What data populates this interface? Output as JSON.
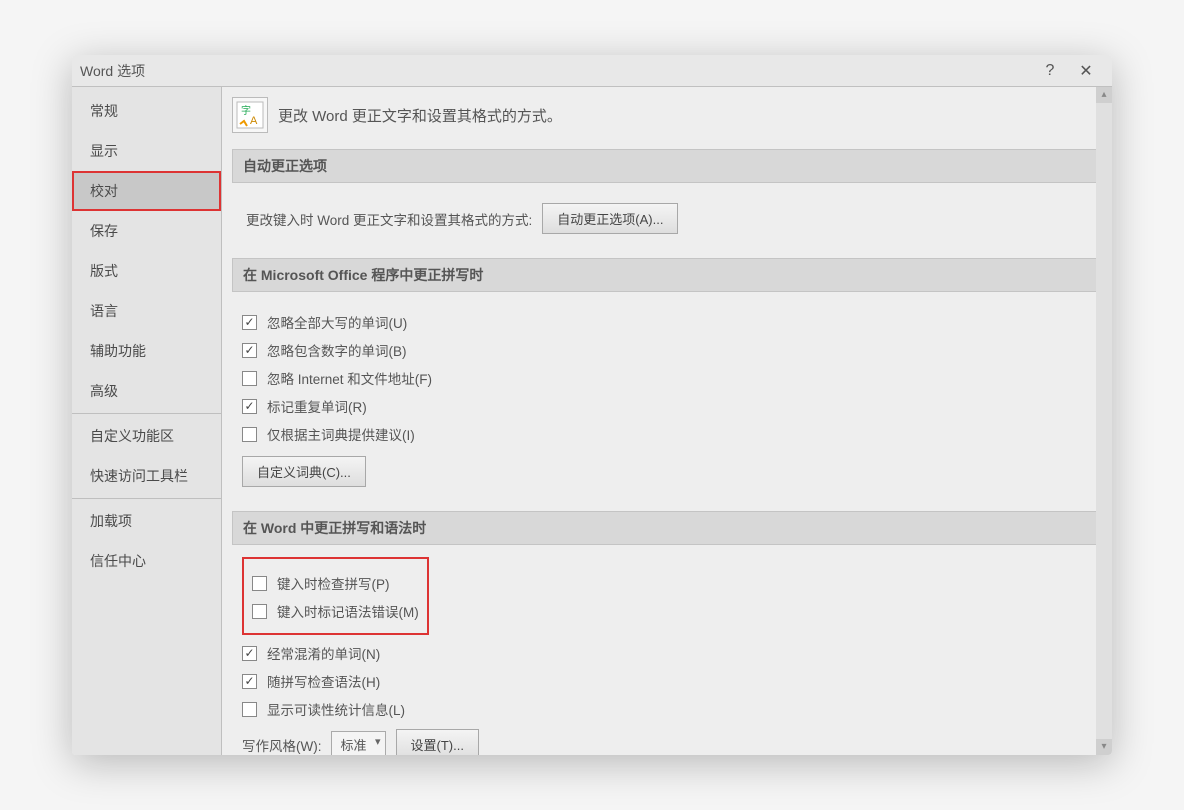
{
  "window": {
    "title": "Word 选项"
  },
  "sidebar": {
    "items": [
      {
        "label": "常规",
        "selected": false
      },
      {
        "label": "显示",
        "selected": false
      },
      {
        "label": "校对",
        "selected": true,
        "highlighted": true
      },
      {
        "label": "保存",
        "selected": false
      },
      {
        "label": "版式",
        "selected": false
      },
      {
        "label": "语言",
        "selected": false
      },
      {
        "label": "辅助功能",
        "selected": false
      },
      {
        "label": "高级",
        "selected": false
      }
    ],
    "items2": [
      {
        "label": "自定义功能区"
      },
      {
        "label": "快速访问工具栏"
      }
    ],
    "items3": [
      {
        "label": "加载项"
      },
      {
        "label": "信任中心"
      }
    ]
  },
  "header": {
    "icon_text": "字A",
    "title": "更改 Word 更正文字和设置其格式的方式。"
  },
  "autocorrect": {
    "section_title": "自动更正选项",
    "desc": "更改键入时 Word 更正文字和设置其格式的方式:",
    "button": "自动更正选项(A)..."
  },
  "office_spell": {
    "section_title": "在 Microsoft Office 程序中更正拼写时",
    "checks": [
      {
        "label": "忽略全部大写的单词(U)",
        "checked": true
      },
      {
        "label": "忽略包含数字的单词(B)",
        "checked": true
      },
      {
        "label": "忽略 Internet 和文件地址(F)",
        "checked": false
      },
      {
        "label": "标记重复单词(R)",
        "checked": true
      },
      {
        "label": "仅根据主词典提供建议(I)",
        "checked": false
      }
    ],
    "dict_button": "自定义词典(C)..."
  },
  "word_spell": {
    "section_title": "在 Word 中更正拼写和语法时",
    "group1": [
      {
        "label": "键入时检查拼写(P)",
        "checked": false
      },
      {
        "label": "键入时标记语法错误(M)",
        "checked": false
      }
    ],
    "group2": [
      {
        "label": "经常混淆的单词(N)",
        "checked": true
      },
      {
        "label": "随拼写检查语法(H)",
        "checked": true
      },
      {
        "label": "显示可读性统计信息(L)",
        "checked": false
      }
    ],
    "style_label": "写作风格(W):",
    "style_value": "标准",
    "settings_button": "设置(T)..."
  }
}
